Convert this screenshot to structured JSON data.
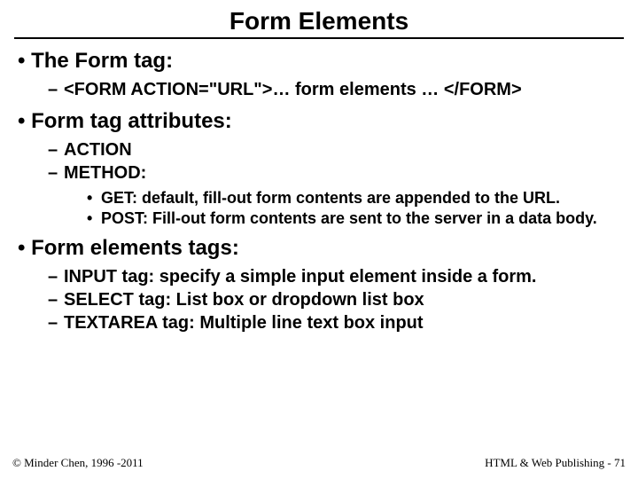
{
  "title": "Form Elements",
  "bullets": {
    "b1": "The Form tag:",
    "b1_s1": "<FORM ACTION=\"URL\">… form elements … </FORM>",
    "b2": "Form tag attributes:",
    "b2_s1": "ACTION",
    "b2_s2": "METHOD:",
    "b2_s2_a": "GET: default, fill-out form contents are appended to the URL.",
    "b2_s2_b": "POST: Fill-out form contents are sent to the server in a data body.",
    "b3": "Form elements tags:",
    "b3_s1": "INPUT tag: specify a simple input element inside a form.",
    "b3_s2": "SELECT tag: List box or dropdown list box",
    "b3_s3": "TEXTAREA tag: Multiple line text box input"
  },
  "footer": {
    "left": "© Minder Chen, 1996 -2011",
    "right": "HTML & Web Publishing - 71"
  }
}
